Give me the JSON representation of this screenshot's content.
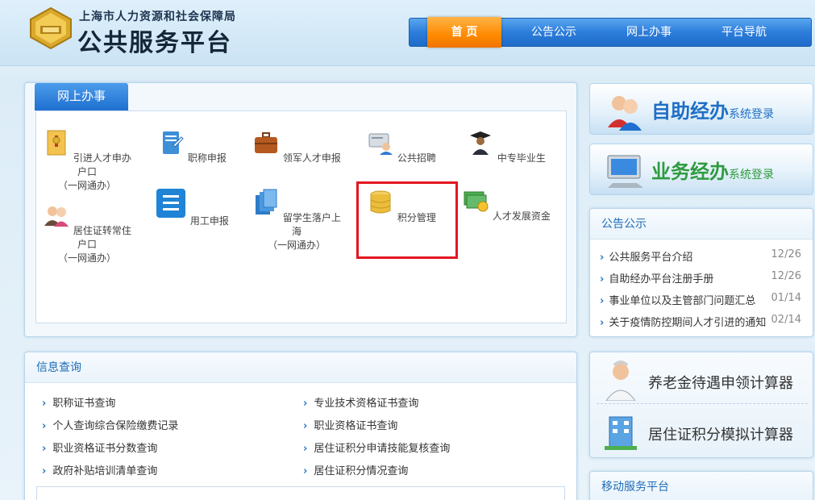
{
  "header": {
    "org_name": "上海市人力资源和社会保障局",
    "platform_name": "公共服务平台",
    "nav": [
      {
        "label": "首 页",
        "active": true
      },
      {
        "label": "公告公示",
        "active": false
      },
      {
        "label": "网上办事",
        "active": false
      },
      {
        "label": "平台导航",
        "active": false
      }
    ]
  },
  "online": {
    "tab": "网上办事",
    "services": [
      {
        "line1": "引进人才申办户口",
        "line2": "（一网通办）",
        "icon": "envelope-icon"
      },
      {
        "line1": "职称申报",
        "line2": "",
        "icon": "certificate-icon"
      },
      {
        "line1": "领军人才申报",
        "line2": "",
        "icon": "briefcase-icon"
      },
      {
        "line1": "公共招聘",
        "line2": "",
        "icon": "recruit-icon"
      },
      {
        "line1": "中专毕业生",
        "line2": "",
        "icon": "graduate-icon"
      },
      {
        "line1": "居住证转常住户口",
        "line2": "（一网通办）",
        "icon": "people-icon"
      },
      {
        "line1": "用工申报",
        "line2": "",
        "icon": "list-icon"
      },
      {
        "line1": "留学生落户上海",
        "line2": "（一网通办）",
        "icon": "documents-icon"
      },
      {
        "line1": "积分管理",
        "line2": "",
        "icon": "database-icon"
      },
      {
        "line1": "人才发展资金",
        "line2": "",
        "icon": "money-icon"
      }
    ]
  },
  "info": {
    "title": "信息查询",
    "left_links": [
      "职称证书查询",
      "个人查询综合保险缴费记录",
      "职业资格证书分数查询",
      "政府补贴培训清单查询"
    ],
    "right_links": [
      "专业技术资格证书查询",
      "职业资格证书查询",
      "居住证积分申请技能复核查询",
      "居住证积分情况查询"
    ]
  },
  "banners": {
    "self_main": "自助经办",
    "self_sub": "系统登录",
    "biz_main": "业务经办",
    "biz_sub": "系统登录"
  },
  "notice": {
    "title": "公告公示",
    "items": [
      {
        "title": "公共服务平台介绍",
        "date": "12/26"
      },
      {
        "title": "自助经办平台注册手册",
        "date": "12/26"
      },
      {
        "title": "事业单位以及主管部门问题汇总",
        "date": "01/14"
      },
      {
        "title": "关于疫情防控期间人才引进的通知",
        "date": "02/14"
      }
    ]
  },
  "calculators": [
    "养老金待遇申领计算器",
    "居住证积分模拟计算器"
  ],
  "mobile": {
    "title": "移动服务平台"
  },
  "colors": {
    "nav_blue": "#2c7ddb",
    "nav_active": "#ff8a00",
    "highlight": "#e3161f",
    "title_blue": "#1e6cb8"
  }
}
